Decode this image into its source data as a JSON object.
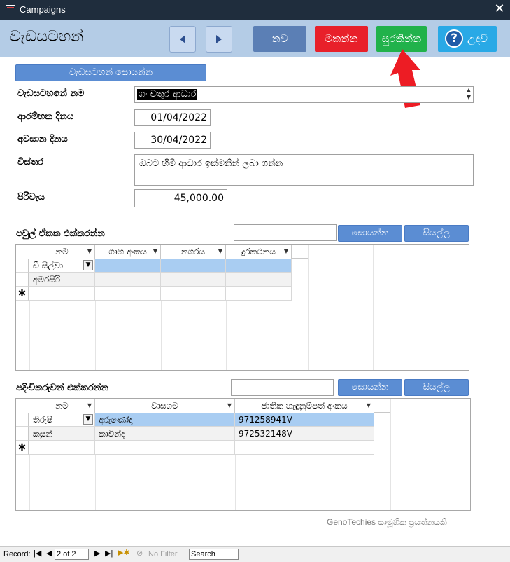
{
  "window": {
    "title": "Campaigns",
    "close_glyph": "✕"
  },
  "header": {
    "form_title": "වැඩසටහන්",
    "prev_icon": "triangle-left-icon",
    "next_icon": "triangle-right-icon",
    "new_label": "නව",
    "delete_label": "මකන්න",
    "save_label": "සුරකින්න",
    "help_label": "උදව්",
    "help_glyph": "?"
  },
  "campaign": {
    "search_button": "වැඩසටහන් සොයන්න",
    "name_label": "වැඩසටහනේ නම",
    "name_value": "ශං චතුර ආධාර",
    "start_label": "ආරම්භක දිනය",
    "start_value": "01/04/2022",
    "end_label": "අවසාන දිනය",
    "end_value": "30/04/2022",
    "desc_label": "විස්තර",
    "desc_value": "ඔබට හිමි ආධාර ඉක්මනින් ලබා ගන්න",
    "cost_label": "පිරිවැය",
    "cost_value": "45,000.00"
  },
  "families": {
    "section_label": "පවුල් ඒකක එක්කරන්න",
    "search_value": "",
    "search_button": "සොයන්න",
    "all_button": "සියල්ල",
    "columns": [
      "නම",
      "ගෘහ අංකය",
      "නගරය",
      "දුරකථනය"
    ],
    "rows": [
      [
        "ඩී සිල්වා",
        "",
        "",
        ""
      ],
      [
        "අමරසිරි",
        "",
        "",
        ""
      ]
    ],
    "new_row_glyph": "✱"
  },
  "volunteers": {
    "section_label": "පදිංචිකරුවන් එක්කරන්න",
    "search_value": "",
    "search_button": "සොයන්න",
    "all_button": "සියල්ල",
    "columns": [
      "නම",
      "වාසගම",
      "ජාතික හැඳුනුම්පත් අංකය"
    ],
    "rows": [
      [
        "තිරුෂි",
        "අරුණෝදා",
        "971258941V"
      ],
      [
        "කසුන්",
        "කාවින්ද",
        "972532148V"
      ]
    ],
    "new_row_glyph": "✱"
  },
  "footer": {
    "credit": "GenoTechies සාමූහික ප්‍රයත්නයකි"
  },
  "statusbar": {
    "record_label": "Record:",
    "record_value": "2 of 2",
    "nofilter_label": "No Filter",
    "search_label": "Search"
  },
  "colors": {
    "new_btn": "#5b7fb5",
    "delete_btn": "#e8202a",
    "save_btn": "#21b24b",
    "help_btn": "#29a9e6",
    "header_band": "#b4cce6",
    "selected_row": "#a9cdf2"
  }
}
